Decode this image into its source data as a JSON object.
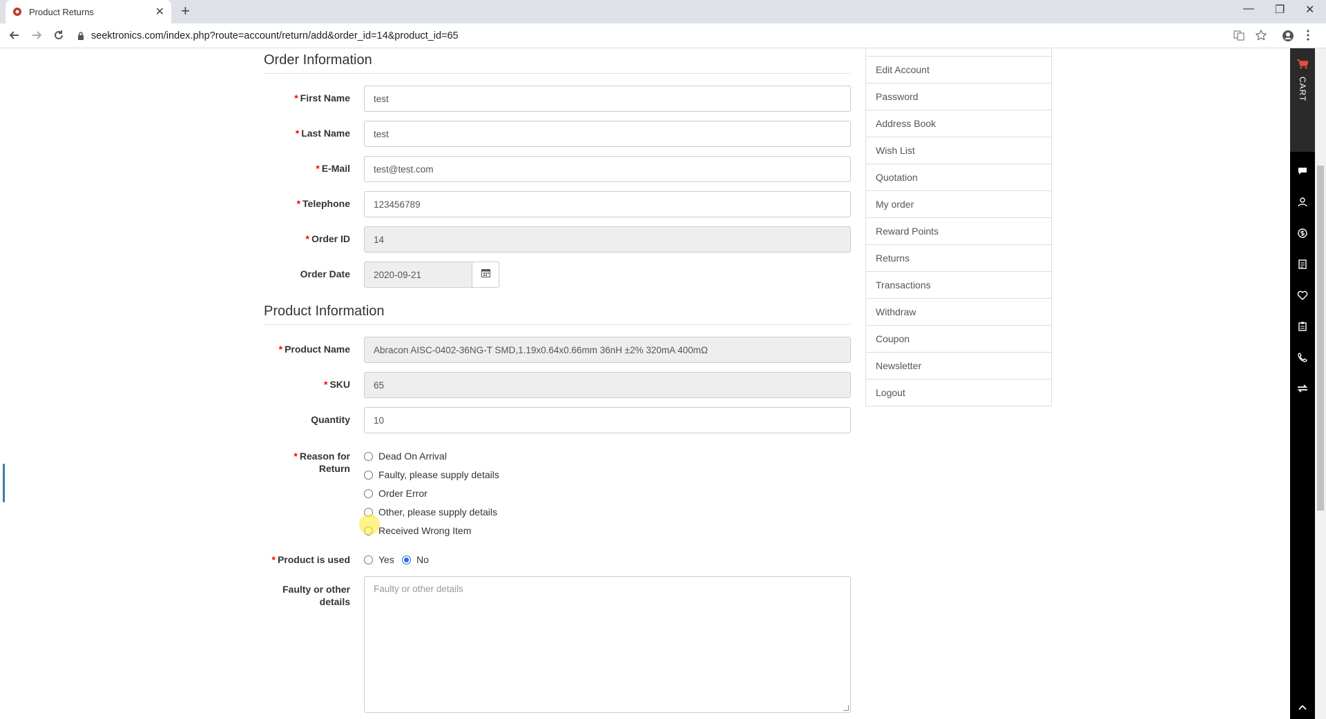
{
  "browser": {
    "tab_title": "Product Returns",
    "tab_close": "✕",
    "new_tab": "+",
    "url": "seektronics.com/index.php?route=account/return/add&order_id=14&product_id=65",
    "win_min": "—",
    "win_restore": "❐",
    "win_close": "✕"
  },
  "order_section": {
    "title": "Order Information",
    "fields": {
      "first_name": {
        "label": "First Name",
        "value": "test"
      },
      "last_name": {
        "label": "Last Name",
        "value": "test"
      },
      "email": {
        "label": "E-Mail",
        "value": "test@test.com"
      },
      "telephone": {
        "label": "Telephone",
        "value": "123456789"
      },
      "order_id": {
        "label": "Order ID",
        "value": "14"
      },
      "order_date": {
        "label": "Order Date",
        "value": "2020-09-21"
      }
    }
  },
  "product_section": {
    "title": "Product Information",
    "fields": {
      "product_name": {
        "label": "Product Name",
        "value": "Abracon AISC-0402-36NG-T SMD,1.19x0.64x0.66mm 36nH ±2% 320mA 400mΩ"
      },
      "sku": {
        "label": "SKU",
        "value": "65"
      },
      "quantity": {
        "label": "Quantity",
        "value": "10"
      }
    },
    "reason": {
      "label_line1": "Reason for",
      "label_line2": "Return",
      "options": [
        "Dead On Arrival",
        "Faulty, please supply details",
        "Order Error",
        "Other, please supply details",
        "Received Wrong Item"
      ]
    },
    "used": {
      "label": "Product is used",
      "yes": "Yes",
      "no": "No",
      "selected": "No"
    },
    "details": {
      "label_line1": "Faulty or other",
      "label_line2": "details",
      "placeholder": "Faulty or other details"
    }
  },
  "account_menu": [
    "Edit Account",
    "Password",
    "Address Book",
    "Wish List",
    "Quotation",
    "My order",
    "Reward Points",
    "Returns",
    "Transactions",
    "Withdraw",
    "Coupon",
    "Newsletter",
    "Logout"
  ],
  "side_toolbar": {
    "cart_label": "CART",
    "icons": [
      "chat-icon",
      "user-icon",
      "coin-icon",
      "document-icon",
      "heart-icon",
      "clipboard-icon",
      "phone-icon",
      "swap-icon"
    ]
  },
  "colors": {
    "required": "#ff0000",
    "radio_selected": "#1a73e8"
  }
}
